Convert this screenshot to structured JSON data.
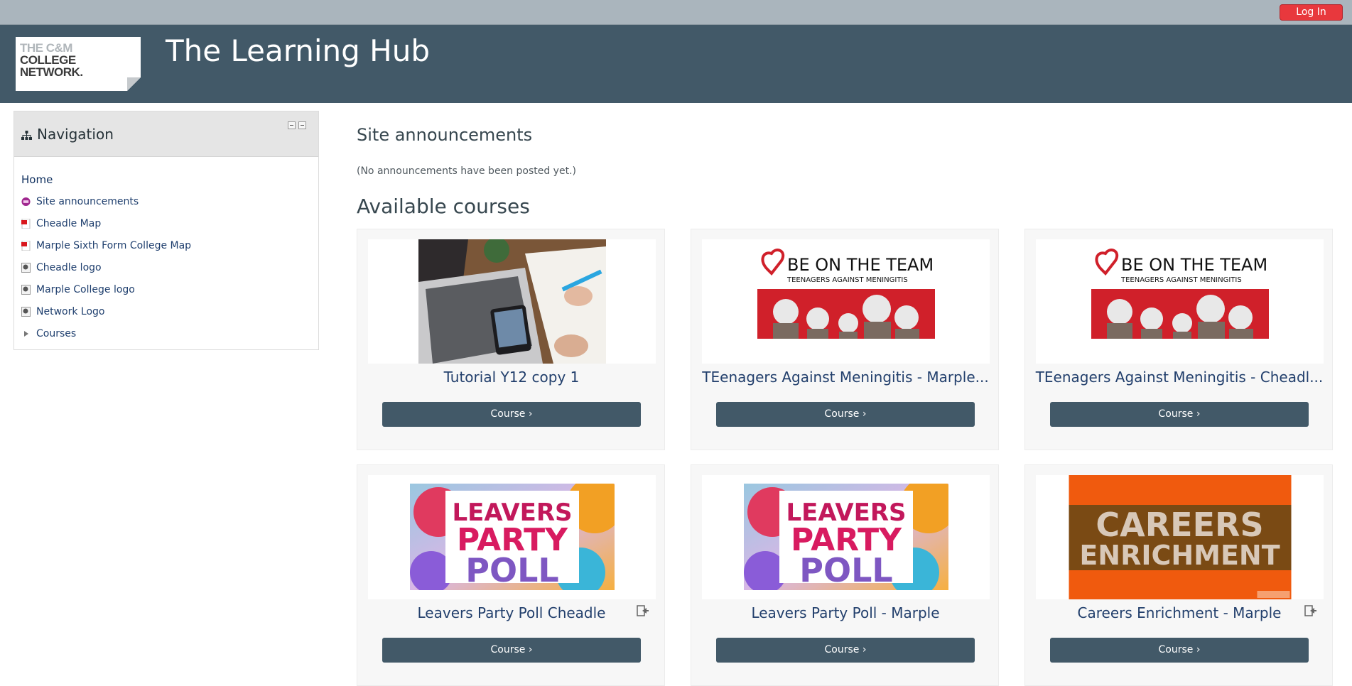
{
  "topbar": {
    "login_label": "Log In"
  },
  "header": {
    "logo_line1": "THE C&M",
    "logo_line2": "COLLEGE",
    "logo_line3": "NETWORK.",
    "site_title": "The Learning Hub"
  },
  "navigation": {
    "title": "Navigation",
    "items": [
      {
        "label": "Home",
        "icon": "none"
      },
      {
        "label": "Site announcements",
        "icon": "forum-icon"
      },
      {
        "label": "Cheadle Map",
        "icon": "pdf-icon"
      },
      {
        "label": "Marple Sixth Form College Map",
        "icon": "pdf-icon"
      },
      {
        "label": "Cheadle logo",
        "icon": "image-icon"
      },
      {
        "label": "Marple College logo",
        "icon": "image-icon"
      },
      {
        "label": "Network Logo",
        "icon": "image-icon"
      },
      {
        "label": "Courses",
        "icon": "expand-arrow-icon"
      }
    ]
  },
  "main": {
    "site_announcements_heading": "Site announcements",
    "no_announcements": "(No announcements have been posted yet.)",
    "available_courses_heading": "Available courses",
    "courses": [
      {
        "name": "Tutorial Y12 copy 1",
        "button": "Course ›",
        "image": "laptop-desk-photo"
      },
      {
        "name": "TEenagers Against Meningitis - Marple...",
        "button": "Course ›",
        "image": "be-on-the-team-banner",
        "banner_title": "BE ON THE TEAM",
        "banner_subtitle": "TEENAGERS AGAINST MENINGITIS"
      },
      {
        "name": "TEenagers Against Meningitis - Cheadl...",
        "button": "Course ›",
        "image": "be-on-the-team-banner",
        "banner_title": "BE ON THE TEAM",
        "banner_subtitle": "TEENAGERS AGAINST MENINGITIS"
      },
      {
        "name": "Leavers Party Poll Cheadle",
        "button": "Course ›",
        "image": "leavers-party-poll-banner",
        "banner_l1": "LEAVERS",
        "banner_l2": "PARTY",
        "banner_l3": "POLL",
        "enrol_icon": true
      },
      {
        "name": "Leavers Party Poll - Marple",
        "button": "Course ›",
        "image": "leavers-party-poll-banner",
        "banner_l1": "LEAVERS",
        "banner_l2": "PARTY",
        "banner_l3": "POLL"
      },
      {
        "name": "Careers Enrichment - Marple",
        "button": "Course ›",
        "image": "careers-enrichment-banner",
        "banner_l1": "CAREERS",
        "banner_l2": "ENRICHMENT",
        "enrol_icon": true
      }
    ]
  },
  "colors": {
    "header_bg": "#425968",
    "topbar_bg": "#aab5bd",
    "login_btn": "#e8383d",
    "course_btn": "#425968"
  }
}
